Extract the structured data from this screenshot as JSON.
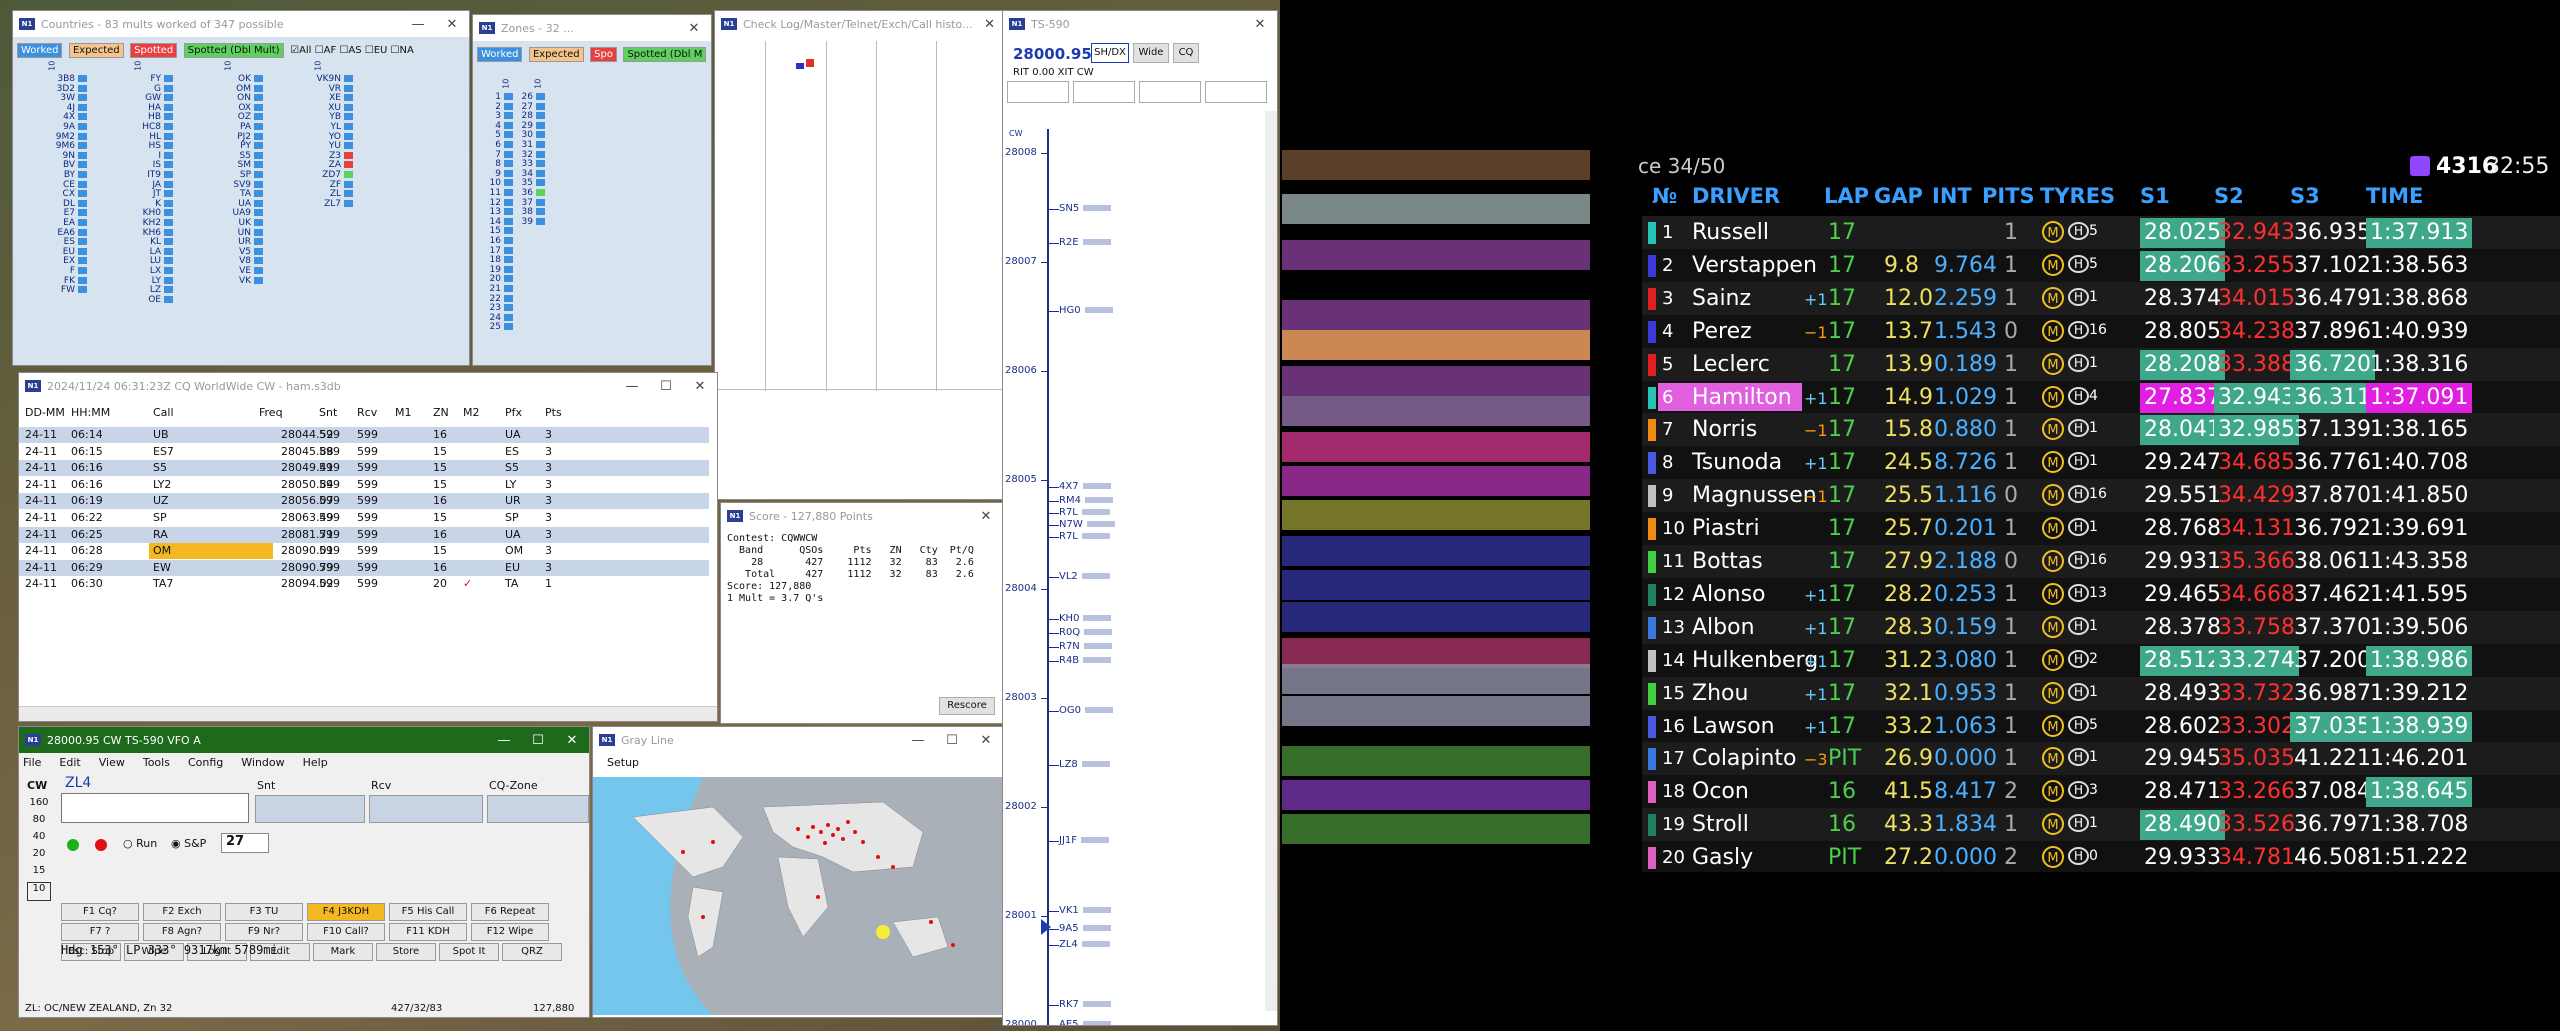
{
  "countries": {
    "title": "Countries - 83 mults worked of 347 possible",
    "tags": [
      "Worked",
      "Expected",
      "Spotted",
      "Spotted (Dbl Mult)"
    ],
    "checks": [
      "All",
      "AF",
      "AS",
      "EU",
      "NA"
    ],
    "band": "10",
    "col1": [
      "3B8",
      "3D2",
      "3W",
      "4J",
      "4X",
      "9A",
      "9M2",
      "9M6",
      "9N",
      "BV",
      "BY",
      "CE",
      "CX",
      "DL",
      "E7",
      "EA",
      "EA6",
      "ES",
      "EU",
      "EX",
      "F",
      "FK",
      "FW"
    ],
    "col2": [
      "FY",
      "G",
      "GW",
      "HA",
      "HB",
      "HC8",
      "HL",
      "HS",
      "I",
      "IS",
      "IT9",
      "JA",
      "JT",
      "K",
      "KH0",
      "KH2",
      "KH6",
      "KL",
      "LA",
      "LU",
      "LX",
      "LY",
      "LZ",
      "OE"
    ],
    "col3": [
      "OK",
      "OM",
      "ON",
      "OX",
      "OZ",
      "PA",
      "PJ2",
      "PY",
      "S5",
      "SM",
      "SP",
      "SV9",
      "TA",
      "UA",
      "UA9",
      "UK",
      "UN",
      "UR",
      "V5",
      "V8",
      "VE",
      "VK"
    ],
    "col4": [
      "VK9N",
      "VR",
      "XE",
      "XU",
      "YB",
      "YL",
      "YO",
      "YU",
      "Z3",
      "ZA",
      "ZD7",
      "ZF",
      "ZL",
      "ZL7"
    ]
  },
  "zones": {
    "title": "Zones - 32 ...",
    "tags": [
      "Worked",
      "Expected",
      "Spo",
      "Spotted (Dbl M"
    ],
    "band": "10",
    "col1": [
      "1",
      "2",
      "3",
      "4",
      "5",
      "6",
      "7",
      "8",
      "9",
      "10",
      "11",
      "12",
      "13",
      "14",
      "15",
      "16",
      "17",
      "18",
      "19",
      "20",
      "21",
      "22",
      "23",
      "24",
      "25"
    ],
    "col2": [
      "26",
      "27",
      "28",
      "29",
      "30",
      "31",
      "32",
      "33",
      "34",
      "35",
      "36",
      "37",
      "38",
      "39"
    ]
  },
  "checklog": {
    "title": "Check Log/Master/Telnet/Exch/Call histo..."
  },
  "bandmap": {
    "title": "TS-590",
    "freq": "28000.95",
    "buttons": [
      "SH/DX",
      "Wide",
      "CQ"
    ],
    "rit_label": "RIT",
    "rit_value": "0.00",
    "xit_label": "XIT",
    "mode": "CW",
    "freq_labels": [
      "28008",
      "28007",
      "28006",
      "28005",
      "28004",
      "28003",
      "28002",
      "28001",
      "28000"
    ],
    "cw": "CW",
    "spots": [
      {
        "call": "SN5"
      },
      {
        "call": "R2E"
      },
      {
        "call": "HG0"
      },
      {
        "call": "4X7"
      },
      {
        "call": "RM4"
      },
      {
        "call": "R7L"
      },
      {
        "call": "N7W"
      },
      {
        "call": "R7L"
      },
      {
        "call": "VL2"
      },
      {
        "call": "KH0"
      },
      {
        "call": "R0Q"
      },
      {
        "call": "R7N"
      },
      {
        "call": "R4B"
      },
      {
        "call": "OG0"
      },
      {
        "call": "LZ8"
      },
      {
        "call": "JJ1F"
      },
      {
        "call": "VK1"
      },
      {
        "call": "9A5"
      },
      {
        "call": "ZL4"
      },
      {
        "call": "RK7"
      },
      {
        "call": "AE5"
      },
      {
        "call": "UW"
      }
    ]
  },
  "log": {
    "title": "2024/11/24 06:31:23Z  CQ WorldWide CW - ham.s3db",
    "headers": [
      "DD-MM",
      "HH:MM",
      "Call",
      "Freq",
      "Snt",
      "Rcv",
      "M1",
      "ZN",
      "M2",
      "Pfx",
      "Pts"
    ],
    "rows": [
      [
        "24-11",
        "06:14",
        "UB",
        "28044.52",
        "599",
        "599",
        "",
        "16",
        "",
        "UA",
        "3"
      ],
      [
        "24-11",
        "06:15",
        "ES7",
        "28045.88",
        "599",
        "599",
        "",
        "15",
        "",
        "ES",
        "3"
      ],
      [
        "24-11",
        "06:16",
        "S5",
        "28049.41",
        "599",
        "599",
        "",
        "15",
        "",
        "S5",
        "3"
      ],
      [
        "24-11",
        "06:16",
        "LY2",
        "28050.84",
        "599",
        "599",
        "",
        "15",
        "",
        "LY",
        "3"
      ],
      [
        "24-11",
        "06:19",
        "UZ",
        "28056.07",
        "599",
        "599",
        "",
        "16",
        "",
        "UR",
        "3"
      ],
      [
        "24-11",
        "06:22",
        "SP",
        "28063.49",
        "599",
        "599",
        "",
        "15",
        "",
        "SP",
        "3"
      ],
      [
        "24-11",
        "06:25",
        "RA",
        "28081.71",
        "599",
        "599",
        "",
        "16",
        "",
        "UA",
        "3"
      ],
      [
        "24-11",
        "06:28",
        "OM",
        "28090.01",
        "599",
        "599",
        "",
        "15",
        "",
        "OM",
        "3"
      ],
      [
        "24-11",
        "06:29",
        "EW",
        "28090.79",
        "599",
        "599",
        "",
        "16",
        "",
        "EU",
        "3"
      ],
      [
        "24-11",
        "06:30",
        "TA7",
        "28094.02",
        "599",
        "599",
        "",
        "20",
        "✓",
        "TA",
        "1"
      ]
    ]
  },
  "score": {
    "title": "Score - 127,880 Points",
    "lines": [
      "Contest: CQWWCW",
      "  Band      QSOs     Pts   ZN   Cty  Pt/Q",
      "    28       427    1112   32    83   2.6",
      "   Total     427    1112   32    83   2.6",
      "Score: 127,880",
      "1 Mult = 3.7 Q's"
    ],
    "rescore": "Rescore"
  },
  "entry": {
    "title": "28000.95 CW TS-590 VFO A",
    "menu": [
      "File",
      "Edit",
      "View",
      "Tools",
      "Config",
      "Window",
      "Help"
    ],
    "mode": "CW",
    "call": "ZL4",
    "labels": [
      "Snt",
      "Rcv",
      "CQ-Zone"
    ],
    "bands": [
      "160",
      "80",
      "40",
      "20",
      "15",
      "10"
    ],
    "run": "Run",
    "sp": "S&P",
    "wpm": "27",
    "fkeys": [
      [
        "F1 Cq?",
        "F2 Exch",
        "F3 TU",
        "F4 J3KDH",
        "F5 His Call",
        "F6 Repeat"
      ],
      [
        "F7 ?",
        "F8 Agn?",
        "F9 Nr?",
        "F10 Call?",
        "F11 KDH",
        "F12 Wipe"
      ],
      [
        "Esc: Stop",
        "Wipe",
        "Log It",
        "Edit",
        "Mark",
        "Store",
        "Spot It",
        "QRZ"
      ]
    ],
    "heading": "Hdg 153°  LP 333°  9317km  5789mi",
    "status_left": "ZL: OC/NEW ZEALAND, Zn 32",
    "status_mid": "427/32/83",
    "status_right": "127,880"
  },
  "grayline": {
    "title": "Gray Line",
    "menu": "Setup"
  },
  "f1": {
    "race": "ce 34/50",
    "viewers": "4316",
    "clock": "32:55",
    "headers": [
      "№",
      "DRIVER",
      "LAP",
      "GAP",
      "INT",
      "PITS",
      "TYRES",
      "S1",
      "S2",
      "S3",
      "TIME"
    ],
    "rows": [
      {
        "pos": "1",
        "name": "Russell",
        "chg": "",
        "lap": "17",
        "gap": "",
        "int": "",
        "pits": "1",
        "tyre": "5",
        "s1": "28.025",
        "s2": "32.943",
        "s3": "36.935",
        "time": "1:37.913",
        "team": "#27c4b8",
        "s1c": "#3fa78a",
        "s2c": "",
        "s3c": "",
        "tc": "#3fa78a"
      },
      {
        "pos": "2",
        "name": "Verstappen",
        "chg": "",
        "lap": "17",
        "gap": "9.8",
        "int": "9.764",
        "pits": "1",
        "tyre": "5",
        "s1": "28.206",
        "s2": "33.255",
        "s3": "37.102",
        "time": "1:38.563",
        "team": "#3a3ad8",
        "s1c": "#3fa78a",
        "s2c": "",
        "s3c": "",
        "tc": ""
      },
      {
        "pos": "3",
        "name": "Sainz",
        "chg": "+1",
        "lap": "17",
        "gap": "12.0",
        "int": "2.259",
        "pits": "1",
        "tyre": "1",
        "s1": "28.374",
        "s2": "34.015",
        "s3": "36.479",
        "time": "1:38.868",
        "team": "#e02020",
        "s1c": "",
        "s2c": "",
        "s3c": "",
        "tc": ""
      },
      {
        "pos": "4",
        "name": "Perez",
        "chg": "−1",
        "lap": "17",
        "gap": "13.7",
        "int": "1.543",
        "pits": "0",
        "tyre": "16",
        "s1": "28.805",
        "s2": "34.238",
        "s3": "37.896",
        "time": "1:40.939",
        "team": "#3a3ad8",
        "s1c": "",
        "s2c": "",
        "s3c": "",
        "tc": ""
      },
      {
        "pos": "5",
        "name": "Leclerc",
        "chg": "",
        "lap": "17",
        "gap": "13.9",
        "int": "0.189",
        "pits": "1",
        "tyre": "1",
        "s1": "28.208",
        "s2": "33.388",
        "s3": "36.720",
        "time": "1:38.316",
        "team": "#e02020",
        "s1c": "#3fa78a",
        "s2c": "",
        "s3c": "#3fa78a",
        "tc": ""
      },
      {
        "pos": "6",
        "name": "Hamilton",
        "chg": "+1",
        "lap": "17",
        "gap": "14.9",
        "int": "1.029",
        "pits": "1",
        "tyre": "4",
        "s1": "27.837",
        "s2": "32.943",
        "s3": "36.311",
        "time": "1:37.091",
        "team": "#27c4b8",
        "s1c": "#e020e0",
        "s2c": "#3fa78a",
        "s3c": "#3fa78a",
        "tc": "#e020e0"
      },
      {
        "pos": "7",
        "name": "Norris",
        "chg": "−1",
        "lap": "17",
        "gap": "15.8",
        "int": "0.880",
        "pits": "1",
        "tyre": "1",
        "s1": "28.041",
        "s2": "32.985",
        "s3": "37.139",
        "time": "1:38.165",
        "team": "#f08a10",
        "s1c": "#3fa78a",
        "s2c": "#3fa78a",
        "s3c": "",
        "tc": ""
      },
      {
        "pos": "8",
        "name": "Tsunoda",
        "chg": "+1",
        "lap": "17",
        "gap": "24.5",
        "int": "8.726",
        "pits": "1",
        "tyre": "1",
        "s1": "29.247",
        "s2": "34.685",
        "s3": "36.776",
        "time": "1:40.708",
        "team": "#4a5ae0",
        "s1c": "",
        "s2c": "",
        "s3c": "",
        "tc": ""
      },
      {
        "pos": "9",
        "name": "Magnussen",
        "chg": "−1",
        "lap": "17",
        "gap": "25.5",
        "int": "1.116",
        "pits": "0",
        "tyre": "16",
        "s1": "29.551",
        "s2": "34.429",
        "s3": "37.870",
        "time": "1:41.850",
        "team": "#c0c0c0",
        "s1c": "",
        "s2c": "",
        "s3c": "",
        "tc": ""
      },
      {
        "pos": "10",
        "name": "Piastri",
        "chg": "",
        "lap": "17",
        "gap": "25.7",
        "int": "0.201",
        "pits": "1",
        "tyre": "1",
        "s1": "28.768",
        "s2": "34.131",
        "s3": "36.792",
        "time": "1:39.691",
        "team": "#f08a10",
        "s1c": "",
        "s2c": "",
        "s3c": "",
        "tc": ""
      },
      {
        "pos": "11",
        "name": "Bottas",
        "chg": "",
        "lap": "17",
        "gap": "27.9",
        "int": "2.188",
        "pits": "0",
        "tyre": "16",
        "s1": "29.931",
        "s2": "35.366",
        "s3": "38.061",
        "time": "1:43.358",
        "team": "#40d040",
        "s1c": "",
        "s2c": "",
        "s3c": "",
        "tc": ""
      },
      {
        "pos": "12",
        "name": "Alonso",
        "chg": "+1",
        "lap": "17",
        "gap": "28.2",
        "int": "0.253",
        "pits": "1",
        "tyre": "13",
        "s1": "29.465",
        "s2": "34.668",
        "s3": "37.462",
        "time": "1:41.595",
        "team": "#208060",
        "s1c": "",
        "s2c": "",
        "s3c": "",
        "tc": ""
      },
      {
        "pos": "13",
        "name": "Albon",
        "chg": "+1",
        "lap": "17",
        "gap": "28.3",
        "int": "0.159",
        "pits": "1",
        "tyre": "1",
        "s1": "28.378",
        "s2": "33.758",
        "s3": "37.370",
        "time": "1:39.506",
        "team": "#3a7ae0",
        "s1c": "",
        "s2c": "",
        "s3c": "",
        "tc": ""
      },
      {
        "pos": "14",
        "name": "Hulkenberg",
        "chg": "+1",
        "lap": "17",
        "gap": "31.2",
        "int": "3.080",
        "pits": "1",
        "tyre": "2",
        "s1": "28.512",
        "s2": "33.274",
        "s3": "37.200",
        "time": "1:38.986",
        "team": "#c0c0c0",
        "s1c": "#3fa78a",
        "s2c": "#3fa78a",
        "s3c": "",
        "tc": "#3fa78a"
      },
      {
        "pos": "15",
        "name": "Zhou",
        "chg": "+1",
        "lap": "17",
        "gap": "32.1",
        "int": "0.953",
        "pits": "1",
        "tyre": "1",
        "s1": "28.493",
        "s2": "33.732",
        "s3": "36.987",
        "time": "1:39.212",
        "team": "#40d040",
        "s1c": "",
        "s2c": "",
        "s3c": "",
        "tc": ""
      },
      {
        "pos": "16",
        "name": "Lawson",
        "chg": "+1",
        "lap": "17",
        "gap": "33.2",
        "int": "1.063",
        "pits": "1",
        "tyre": "5",
        "s1": "28.602",
        "s2": "33.302",
        "s3": "37.035",
        "time": "1:38.939",
        "team": "#4a5ae0",
        "s1c": "",
        "s2c": "",
        "s3c": "#3fa78a",
        "tc": "#3fa78a"
      },
      {
        "pos": "17",
        "name": "Colapinto",
        "chg": "−3",
        "lap": "PIT",
        "gap": "26.9",
        "int": "0.000",
        "pits": "1",
        "tyre": "1",
        "s1": "29.945",
        "s2": "35.035",
        "s3": "41.221",
        "time": "1:46.201",
        "team": "#3a7ae0",
        "s1c": "",
        "s2c": "",
        "s3c": "",
        "tc": ""
      },
      {
        "pos": "18",
        "name": "Ocon",
        "chg": "",
        "lap": "16",
        "gap": "41.5",
        "int": "8.417",
        "pits": "2",
        "tyre": "3",
        "s1": "28.471",
        "s2": "33.266",
        "s3": "37.084",
        "time": "1:38.645",
        "team": "#e060c0",
        "s1c": "",
        "s2c": "",
        "s3c": "",
        "tc": "#3fa78a"
      },
      {
        "pos": "19",
        "name": "Stroll",
        "chg": "",
        "lap": "16",
        "gap": "43.3",
        "int": "1.834",
        "pits": "1",
        "tyre": "1",
        "s1": "28.490",
        "s2": "33.526",
        "s3": "36.797",
        "time": "1:38.708",
        "team": "#208060",
        "s1c": "#3fa78a",
        "s2c": "",
        "s3c": "",
        "tc": ""
      },
      {
        "pos": "20",
        "name": "Gasly",
        "chg": "",
        "lap": "PIT",
        "gap": "27.2",
        "int": "0.000",
        "pits": "2",
        "tyre": "0",
        "s1": "29.933",
        "s2": "34.781",
        "s3": "46.508",
        "time": "1:51.222",
        "team": "#e060c0",
        "s1c": "",
        "s2c": "",
        "s3c": "",
        "tc": ""
      }
    ]
  }
}
